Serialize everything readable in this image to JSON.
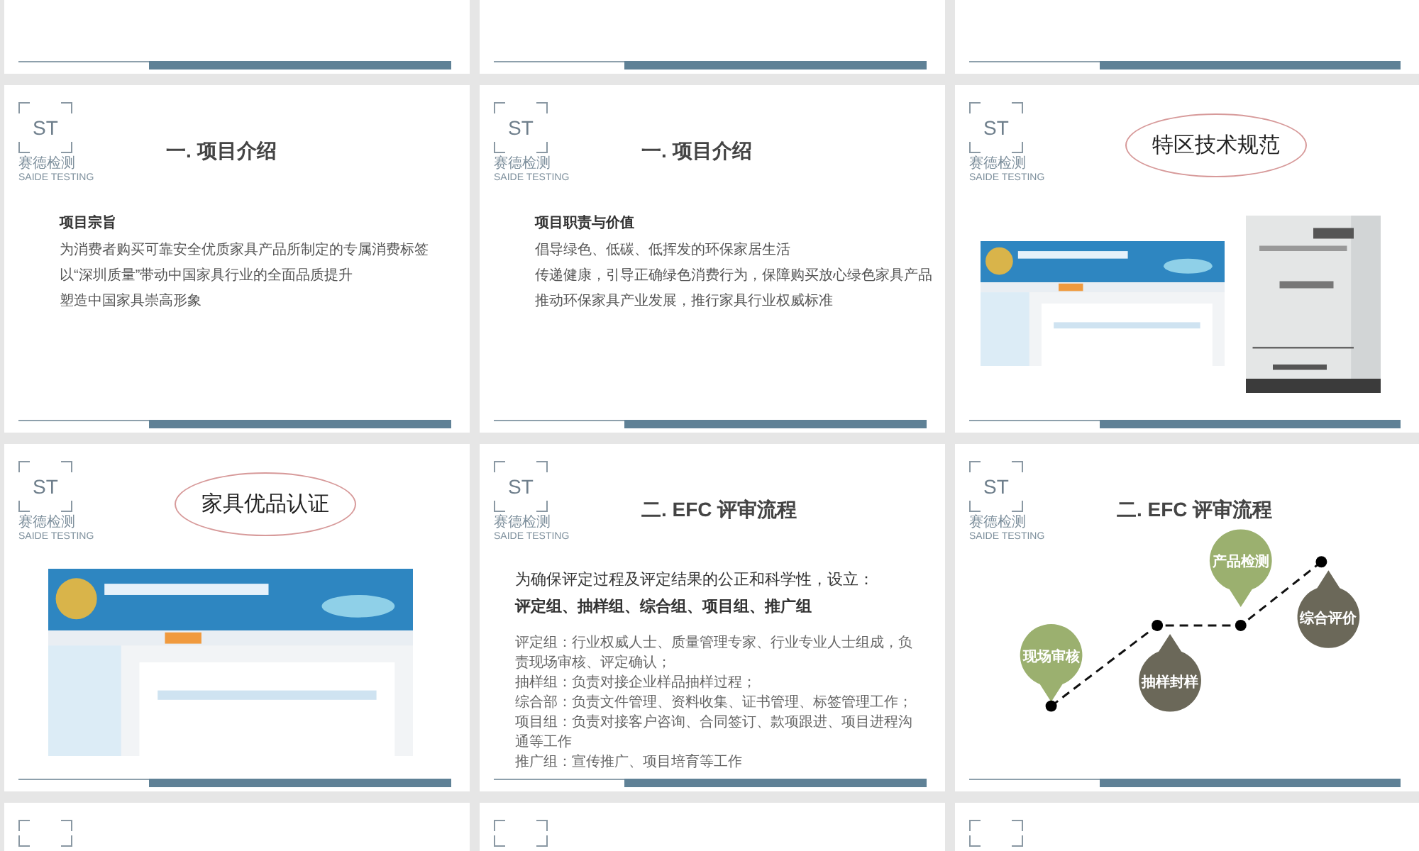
{
  "slides": [
    {
      "kind": "blank"
    },
    {
      "kind": "blank"
    },
    {
      "kind": "blank"
    },
    {
      "kind": "text",
      "logo": {
        "mark": "ST",
        "name": "赛德检测",
        "name_en": "SAIDE TESTING"
      },
      "title": "一. 项目介绍",
      "heading": "项目宗旨",
      "lines": [
        "为消费者购买可靠安全优质家具产品所制定的专属消费标签",
        "以“深圳质量”带动中国家具行业的全面品质提升",
        "塑造中国家具崇高形象"
      ]
    },
    {
      "kind": "text",
      "logo": {
        "mark": "ST",
        "name": "赛德检测",
        "name_en": "SAIDE TESTING"
      },
      "title": "一. 项目介绍",
      "heading": "项目职责与价值",
      "lines": [
        "倡导绿色、低碳、低挥发的环保家居生活",
        "传递健康，引导正确绿色消费行为，保障购买放心绿色家具产品",
        "推动环保家具产业发展，推行家具行业权威标准"
      ]
    },
    {
      "kind": "images",
      "logo": {
        "mark": "ST",
        "name": "赛德检测",
        "name_en": "SAIDE TESTING"
      },
      "title": "特区技术规范"
    },
    {
      "kind": "images",
      "logo": {
        "mark": "ST",
        "name": "赛德检测",
        "name_en": "SAIDE TESTING"
      },
      "title": "家具优品认证"
    },
    {
      "kind": "groups",
      "logo": {
        "mark": "ST",
        "name": "赛德检测",
        "name_en": "SAIDE TESTING"
      },
      "title": "二. EFC 评审流程",
      "intro": "为确保评定过程及评定结果的公正和科学性，设立：",
      "group_names": "评定组、抽样组、综合组、项目组、推广组",
      "lines": [
        "评定组：行业权威人士、质量管理专家、行业专业人士组成，负责现场审核、评定确认；",
        "抽样组：负责对接企业样品抽样过程；",
        "综合部：负责文件管理、资料收集、证书管理、标签管理工作；",
        "项目组：负责对接客户咨询、合同签订、款项跟进、项目进程沟通等工作",
        "推广组：宣传推广、项目培育等工作"
      ]
    },
    {
      "kind": "flow",
      "logo": {
        "mark": "ST",
        "name": "赛德检测",
        "name_en": "SAIDE TESTING"
      },
      "title": "二. EFC 评审流程",
      "steps": [
        {
          "label": "现场审核",
          "color": "#9bb06f"
        },
        {
          "label": "抽样封样",
          "color": "#6b6859"
        },
        {
          "label": "产品检测",
          "color": "#9bb06f"
        },
        {
          "label": "综合评价",
          "color": "#6b6859"
        }
      ]
    },
    {
      "kind": "top"
    },
    {
      "kind": "top"
    },
    {
      "kind": "top"
    }
  ]
}
